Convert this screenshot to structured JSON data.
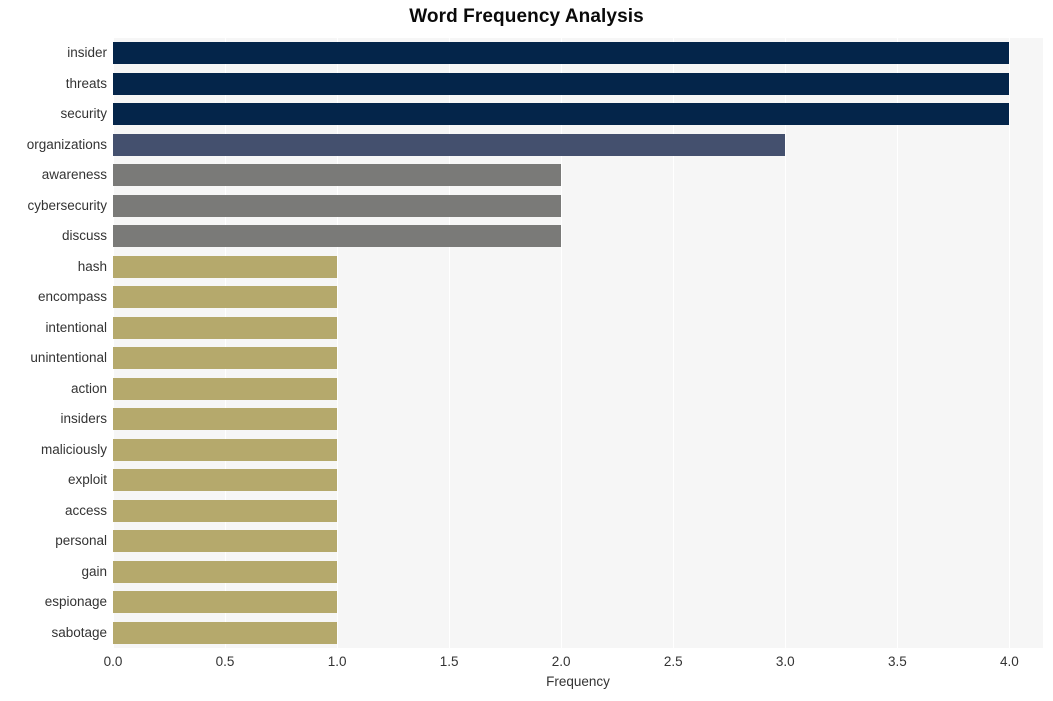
{
  "chart_data": {
    "type": "bar",
    "orientation": "horizontal",
    "title": "Word Frequency Analysis",
    "xlabel": "Frequency",
    "ylabel": "",
    "xlim": [
      0,
      4.15
    ],
    "xticks": [
      0.0,
      0.5,
      1.0,
      1.5,
      2.0,
      2.5,
      3.0,
      3.5,
      4.0
    ],
    "xtick_labels": [
      "0.0",
      "0.5",
      "1.0",
      "1.5",
      "2.0",
      "2.5",
      "3.0",
      "3.5",
      "4.0"
    ],
    "grid": true,
    "grid_color": "#ffffff",
    "plot_background": "#f6f6f6",
    "legend": null,
    "categories": [
      "insider",
      "threats",
      "security",
      "organizations",
      "awareness",
      "cybersecurity",
      "discuss",
      "hash",
      "encompass",
      "intentional",
      "unintentional",
      "action",
      "insiders",
      "maliciously",
      "exploit",
      "access",
      "personal",
      "gain",
      "espionage",
      "sabotage"
    ],
    "values": [
      4,
      4,
      4,
      3,
      2,
      2,
      2,
      1,
      1,
      1,
      1,
      1,
      1,
      1,
      1,
      1,
      1,
      1,
      1,
      1
    ],
    "bar_colors": [
      "#04254a",
      "#04254a",
      "#04254a",
      "#44506e",
      "#7a7a78",
      "#7a7a78",
      "#7a7a78",
      "#b5a96c",
      "#b5a96c",
      "#b5a96c",
      "#b5a96c",
      "#b5a96c",
      "#b5a96c",
      "#b5a96c",
      "#b5a96c",
      "#b5a96c",
      "#b5a96c",
      "#b5a96c",
      "#b5a96c",
      "#b5a96c"
    ]
  },
  "colors": {
    "title": "#0a0a0a",
    "tick_label": "#333333",
    "plot_bg": "#f6f6f6",
    "figure_bg": "#ffffff",
    "grid": "#ffffff"
  }
}
